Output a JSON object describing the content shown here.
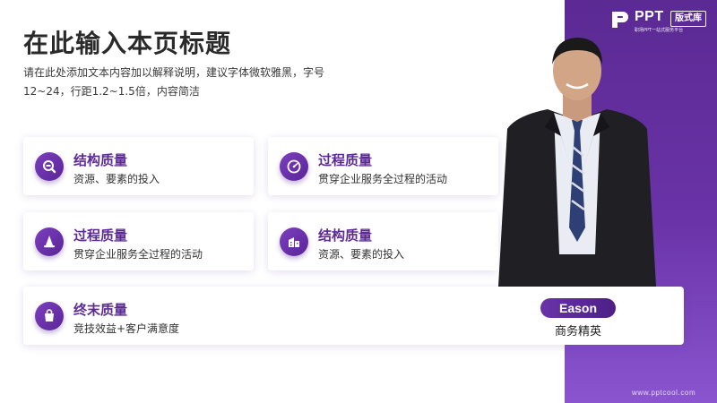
{
  "brand": {
    "name": "PPT",
    "badge": "版式库",
    "tagline": "职场PPT一站式服务平台",
    "site": "www.pptcool.com"
  },
  "header": {
    "title": "在此输入本页标题",
    "desc_line1": "请在此处添加文本内容加以解释说明，建议字体微软雅黑，字号",
    "desc_line2": "12~24，行距1.2~1.5倍，内容简洁"
  },
  "cards": [
    {
      "title": "结构质量",
      "text": "资源、要素的投入",
      "icon": "search-minus-icon"
    },
    {
      "title": "过程质量",
      "text": "贯穿企业服务全过程的活动",
      "icon": "gauge-icon"
    },
    {
      "title": "过程质量",
      "text": "贯穿企业服务全过程的活动",
      "icon": "wizard-hat-icon"
    },
    {
      "title": "结构质量",
      "text": "资源、要素的投入",
      "icon": "building-icon"
    },
    {
      "title": "终末质量",
      "text": "竞技效益+客户满意度",
      "icon": "shopping-bag-icon"
    }
  ],
  "person": {
    "name": "Eason",
    "role": "商务精英"
  },
  "colors": {
    "accent": "#5b2a93",
    "panel": "#6a33a8"
  }
}
